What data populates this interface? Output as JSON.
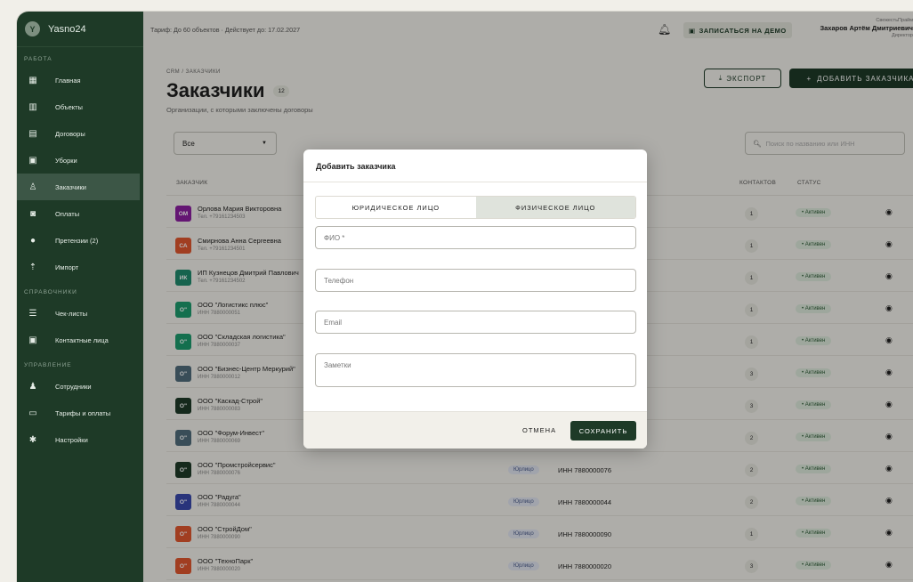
{
  "app": {
    "name": "Yasno24",
    "logo_letter": "Y"
  },
  "sidebar": {
    "sections": [
      "РАБОТА",
      "СПРАВОЧНИКИ",
      "УПРАВЛЕНИЕ"
    ],
    "items": [
      {
        "label": "Главная",
        "icon": "dashboard-icon"
      },
      {
        "label": "Объекты",
        "icon": "building-icon"
      },
      {
        "label": "Договоры",
        "icon": "document-icon"
      },
      {
        "label": "Уборки",
        "icon": "calendar-icon"
      },
      {
        "label": "Заказчики",
        "icon": "customers-icon"
      },
      {
        "label": "Оплаты",
        "icon": "payments-icon"
      },
      {
        "label": "Претензии (2)",
        "icon": "alert-icon"
      },
      {
        "label": "Импорт",
        "icon": "upload-icon"
      },
      {
        "label": "Чек-листы",
        "icon": "checklist-icon"
      },
      {
        "label": "Контактные лица",
        "icon": "contacts-icon"
      },
      {
        "label": "Сотрудники",
        "icon": "people-icon"
      },
      {
        "label": "Тарифы и оплаты",
        "icon": "card-icon"
      },
      {
        "label": "Настройки",
        "icon": "gear-icon"
      }
    ]
  },
  "topbar": {
    "tariff": "Тариф: До 60 объектов · Действует до: 17.02.2027",
    "demo_label": "ЗАПИСАТЬСЯ НА ДЕМО",
    "company": "СвежестьПрайм",
    "user_name": "Захаров Артём Дмитриевич",
    "user_role": "Директор"
  },
  "page": {
    "breadcrumb": "CRM / ЗАКАЗЧИКИ",
    "title": "Заказчики",
    "count": "12",
    "subtitle": "Организации, с которыми заключены договоры",
    "export_label": "ЭКСПОРТ",
    "add_label": "ДОБАВИТЬ ЗАКАЗЧИКА",
    "filter_value": "Все",
    "search_placeholder": "Поиск по названию или ИНН"
  },
  "table": {
    "headers": {
      "customer": "ЗАКАЗЧИК",
      "contacts": "КОНТАКТОВ",
      "status": "СТАТУС"
    },
    "rows": [
      {
        "initials": "ОМ",
        "color": "#8b1fa0",
        "name": "Орлова Мария Викторовна",
        "sub": "Тел. +79161234503",
        "type": "",
        "inn": "",
        "contacts": "1",
        "status": "• Активен"
      },
      {
        "initials": "СА",
        "color": "#e0562e",
        "name": "Смирнова Анна Сергеевна",
        "sub": "Тел. +79161234501",
        "type": "",
        "inn": "",
        "contacts": "1",
        "status": "• Активен"
      },
      {
        "initials": "ИК",
        "color": "#1f8a6d",
        "name": "ИП Кузнецов Дмитрий Павлович",
        "sub": "Тел. +79161234502",
        "type": "",
        "inn": "",
        "contacts": "1",
        "status": "• Активен"
      },
      {
        "initials": "О\"",
        "color": "#1c9a6c",
        "name": "ООО \"Логистикс плюс\"",
        "sub": "ИНН 7880000051",
        "type": "",
        "inn": "",
        "contacts": "1",
        "status": "• Активен"
      },
      {
        "initials": "О\"",
        "color": "#1c9a6c",
        "name": "ООО \"Складская логистика\"",
        "sub": "ИНН 7880000037",
        "type": "",
        "inn": "",
        "contacts": "1",
        "status": "• Активен"
      },
      {
        "initials": "О\"",
        "color": "#4f6b7a",
        "name": "ООО \"Бизнес-Центр Меркурий\"",
        "sub": "ИНН 7880000012",
        "type": "",
        "inn": "",
        "contacts": "3",
        "status": "• Активен"
      },
      {
        "initials": "О\"",
        "color": "#1e3a27",
        "name": "ООО \"Каскад-Строй\"",
        "sub": "ИНН 7880000083",
        "type": "",
        "inn": "",
        "contacts": "3",
        "status": "• Активен"
      },
      {
        "initials": "О\"",
        "color": "#4f6b7a",
        "name": "ООО \"Форум-Инвест\"",
        "sub": "ИНН 7880000069",
        "type": "",
        "inn": "",
        "contacts": "2",
        "status": "• Активен"
      },
      {
        "initials": "О\"",
        "color": "#1e3a27",
        "name": "ООО \"Промстройсервис\"",
        "sub": "ИНН 7880000076",
        "type": "Юрлицо",
        "inn": "ИНН 7880000076",
        "contacts": "2",
        "status": "• Активен"
      },
      {
        "initials": "О\"",
        "color": "#3949ab",
        "name": "ООО \"Радуга\"",
        "sub": "ИНН 7880000044",
        "type": "Юрлицо",
        "inn": "ИНН 7880000044",
        "contacts": "2",
        "status": "• Активен"
      },
      {
        "initials": "О\"",
        "color": "#e0562e",
        "name": "ООО \"СтройДом\"",
        "sub": "ИНН 7880000090",
        "type": "Юрлицо",
        "inn": "ИНН 7880000090",
        "contacts": "1",
        "status": "• Активен"
      },
      {
        "initials": "О\"",
        "color": "#e0562e",
        "name": "ООО \"ТехноПарк\"",
        "sub": "ИНН 7880000020",
        "type": "Юрлицо",
        "inn": "ИНН 7880000020",
        "contacts": "3",
        "status": "• Активен"
      }
    ]
  },
  "modal": {
    "title": "Добавить заказчика",
    "tab_legal": "ЮРИДИЧЕСКОЕ ЛИЦО",
    "tab_person": "ФИЗИЧЕСКОЕ ЛИЦО",
    "fio_placeholder": "ФИО *",
    "phone_placeholder": "Телефон",
    "email_placeholder": "Email",
    "notes_placeholder": "Заметки",
    "cancel_label": "ОТМЕНА",
    "save_label": "СОХРАНИТЬ"
  }
}
